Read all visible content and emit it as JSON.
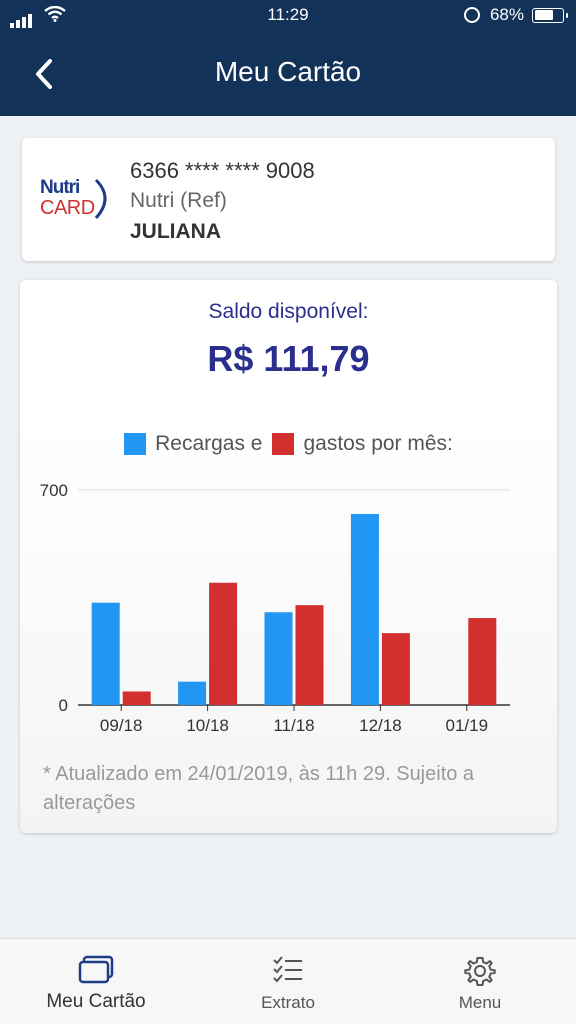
{
  "status_bar": {
    "time": "11:29",
    "battery": "68%"
  },
  "header": {
    "title": "Meu Cartão"
  },
  "card": {
    "logo_text_top": "Nutri",
    "logo_text_bottom": "CARD",
    "number": "6366 **** **** 9008",
    "type": "Nutri (Ref)",
    "holder": "JULIANA"
  },
  "balance": {
    "label": "Saldo disponível:",
    "value": "R$ 111,79"
  },
  "legend": {
    "recargas": "Recargas e",
    "gastos": "gastos por mês:"
  },
  "colors": {
    "recargas": "#2196f3",
    "gastos": "#d32f2f",
    "header": "#123258",
    "accent": "#2a2f8e"
  },
  "chart_data": {
    "type": "bar",
    "categories": [
      "09/18",
      "10/18",
      "11/18",
      "12/18",
      "01/19"
    ],
    "series": [
      {
        "name": "Recargas",
        "values": [
          333,
          76,
          302,
          622,
          0
        ]
      },
      {
        "name": "gastos",
        "values": [
          44,
          398,
          325,
          234,
          283
        ]
      }
    ],
    "ylim": [
      0,
      700
    ],
    "yticks": [
      0,
      700
    ],
    "grid": true
  },
  "footnote": "* Atualizado em 24/01/2019, às 11h 29. Sujeito a alterações",
  "tabbar": {
    "tabs": [
      {
        "label": "Meu Cartão",
        "icon": "card-icon",
        "active": true
      },
      {
        "label": "Extrato",
        "icon": "checklist-icon",
        "active": false
      },
      {
        "label": "Menu",
        "icon": "gear-icon",
        "active": false
      }
    ]
  }
}
